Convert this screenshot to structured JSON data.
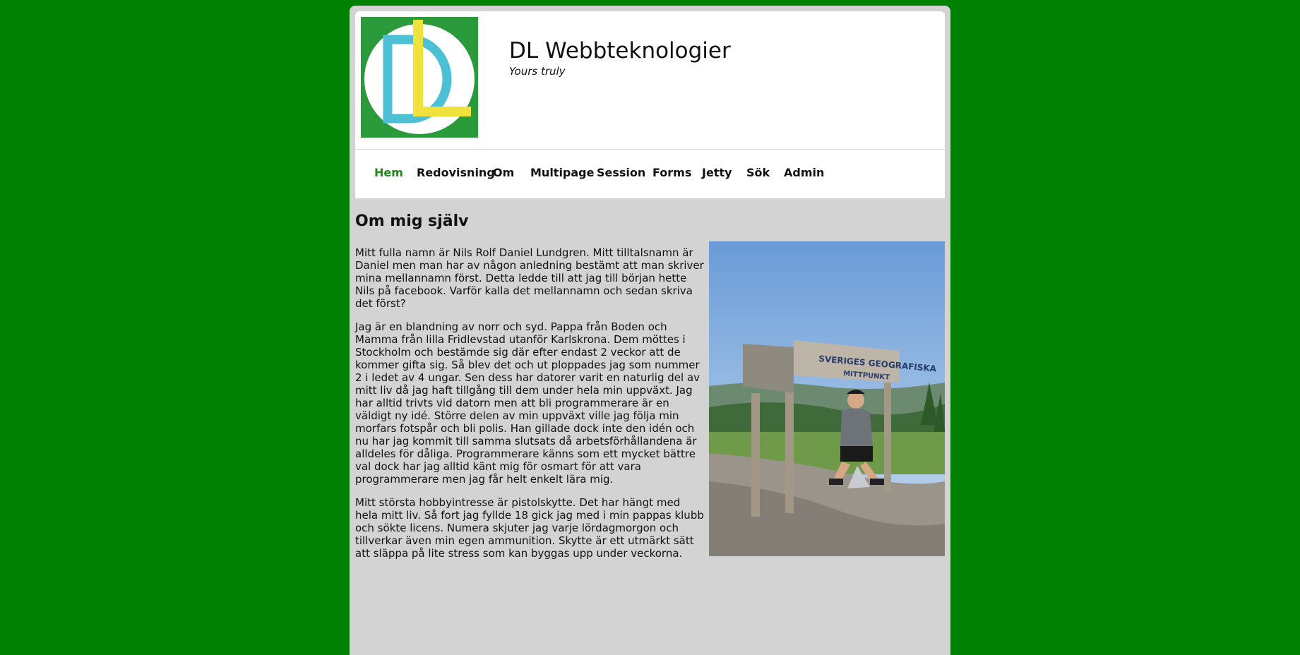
{
  "header": {
    "logo_text": "DL",
    "title": "DL Webbteknologier",
    "tagline": "Yours truly"
  },
  "nav": {
    "items": [
      {
        "label": "Hem",
        "active": true
      },
      {
        "label": "Redovisning",
        "active": false
      },
      {
        "label": "Om",
        "active": false
      },
      {
        "label": "Multipage",
        "active": false
      },
      {
        "label": "Session",
        "active": false
      },
      {
        "label": "Forms",
        "active": false
      },
      {
        "label": "Jetty",
        "active": false
      },
      {
        "label": "Sök",
        "active": false
      },
      {
        "label": "Admin",
        "active": false
      }
    ]
  },
  "main": {
    "heading": "Om mig själv",
    "paragraphs": [
      "Mitt fulla namn är Nils Rolf Daniel Lundgren. Mitt tilltalsnamn är Daniel men man har av någon anledning bestämt att man skriver mina mellannamn först. Detta ledde till att jag till början hette Nils på facebook. Varför kalla det mellannamn och sedan skriva det först?",
      "Jag är en blandning av norr och syd. Pappa från Boden och Mamma från lilla Fridlevstad utanför Karlskrona. Dem möttes i Stockholm och bestämde sig där efter endast 2 veckor att de kommer gifta sig. Så blev det och ut ploppades jag som nummer 2 i ledet av 4 ungar. Sen dess har datorer varit en naturlig del av mitt liv då jag haft tillgång till dem under hela min uppväxt. Jag har alltid trivts vid datorn men att bli programmerare är en väldigt ny idé. Större delen av min uppväxt ville jag följa min morfars fotspår och bli polis. Han gillade dock inte den idén och nu har jag kommit till samma slutsats då arbetsförhållandena är alldeles för dåliga. Programmerare känns som ett mycket bättre val dock har jag alltid känt mig för osmart för att vara programmerare men jag får helt enkelt lära mig.",
      "Mitt största hobbyintresse är pistolskytte. Det har hängt med hela mitt liv. Så fort jag fyllde 18 gick jag med i min pappas klubb och sökte licens. Numera skjuter jag varje lördagmorgon och tillverkar även min egen ammunition. Skytte är ett utmärkt sätt att släppa på lite stress som kan byggas upp under veckorna."
    ],
    "photo": {
      "sign_line1": "SVERIGES  GEOGRAFISKA",
      "sign_line2": "MITTPUNKT"
    }
  },
  "colors": {
    "background": "#008000",
    "nav_active": "#1a8a1a",
    "logo_bg": "#2a9a3a",
    "logo_d": "#4dc0d6",
    "logo_l": "#f0e23a"
  }
}
